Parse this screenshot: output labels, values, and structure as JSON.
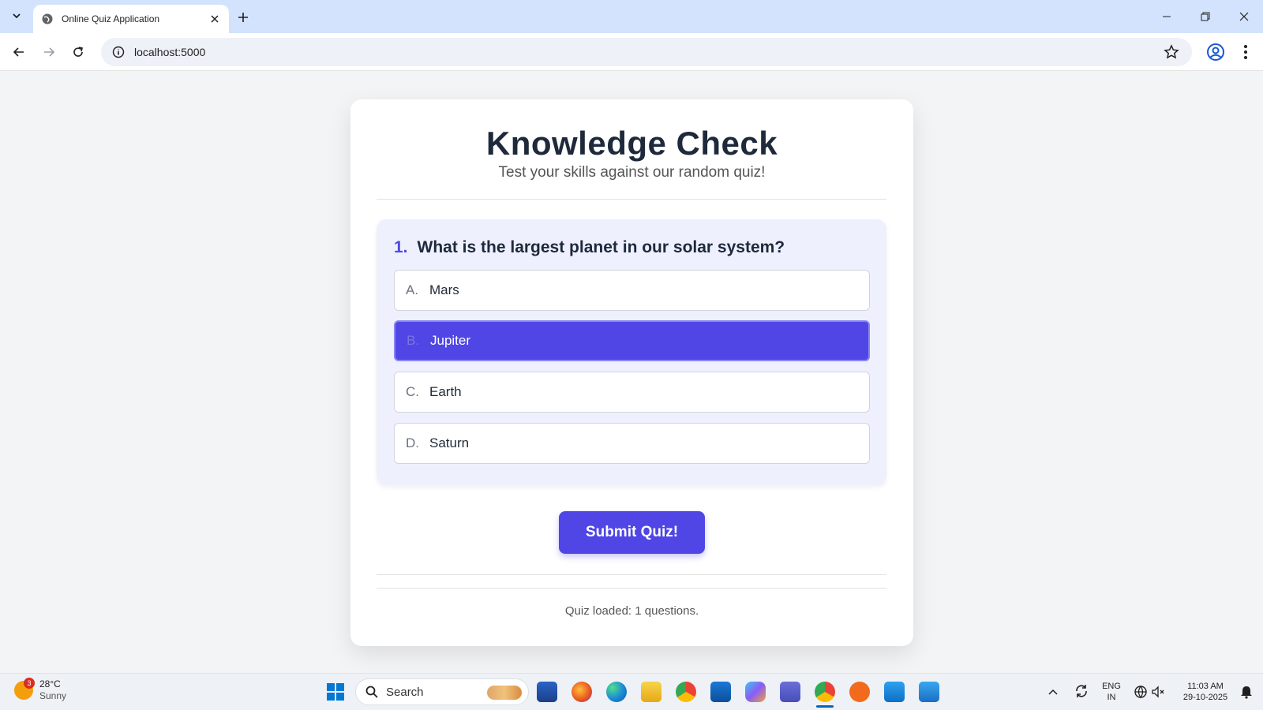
{
  "browser": {
    "tab_title": "Online Quiz Application",
    "url": "localhost:5000"
  },
  "quiz": {
    "title": "Knowledge Check",
    "subtitle": "Test your skills against our random quiz!",
    "question_number": "1.",
    "question_text": "What is the largest planet in our solar system?",
    "options": [
      {
        "letter": "A.",
        "text": "Mars",
        "selected": false
      },
      {
        "letter": "B.",
        "text": "Jupiter",
        "selected": true
      },
      {
        "letter": "C.",
        "text": "Earth",
        "selected": false
      },
      {
        "letter": "D.",
        "text": "Saturn",
        "selected": false
      }
    ],
    "submit_label": "Submit Quiz!",
    "status_text": "Quiz loaded: 1 questions."
  },
  "taskbar": {
    "weather_temp": "28°C",
    "weather_desc": "Sunny",
    "weather_badge": "3",
    "search_label": "Search",
    "lang_top": "ENG",
    "lang_bottom": "IN",
    "time": "11:03 AM",
    "date": "29-10-2025"
  },
  "colors": {
    "accent": "#4f46e5",
    "tabstrip": "#d3e3fd"
  }
}
